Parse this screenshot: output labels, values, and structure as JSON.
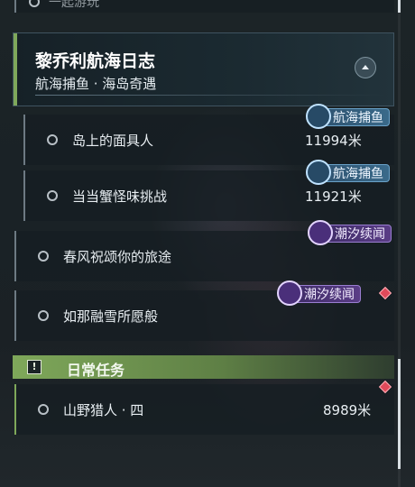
{
  "top_partial_label": "一起游玩",
  "quest_header": {
    "title": "黎乔利航海日志",
    "subtitle": "航海捕鱼 · 海岛奇遇"
  },
  "tasks": [
    {
      "label": "岛上的面具人",
      "distance": "11994米",
      "tag": "航海捕鱼",
      "tag_icon": "anchor-icon"
    },
    {
      "label": "当当蟹怪味挑战",
      "distance": "11921米",
      "tag": "航海捕鱼",
      "tag_icon": "anchor-icon"
    },
    {
      "label": "春风祝颂你的旅途",
      "tag": "潮汐续闻",
      "tag_icon": "star-icon"
    },
    {
      "label": "如那融雪所愿般",
      "tag": "潮汐续闻",
      "tag_icon": "star-icon"
    }
  ],
  "daily_section": {
    "title": "日常任务",
    "task": {
      "label": "山野猎人 · 四",
      "distance": "8989米"
    }
  },
  "colors": {
    "accent_green": "#7fa85a",
    "tag_fishing": "#3a6a8a",
    "tag_tide": "#5a3d86",
    "new_marker": "#e04a5a"
  }
}
